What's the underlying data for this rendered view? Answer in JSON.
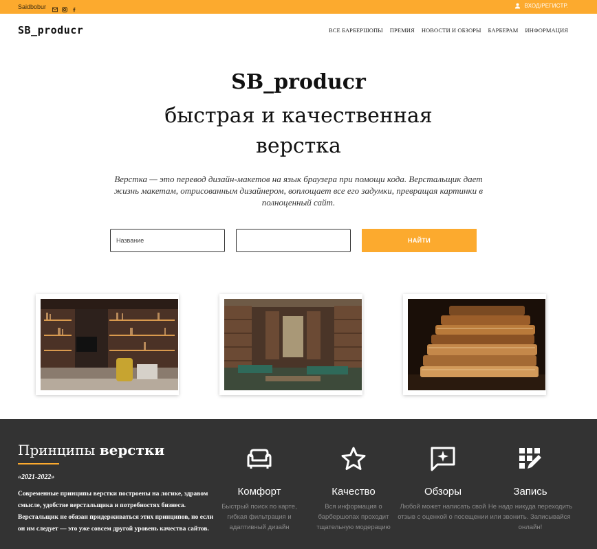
{
  "topbar": {
    "brand": "Saidbobur",
    "socials": [
      "mail-icon",
      "instagram-icon",
      "facebook-icon"
    ],
    "login_label": "ВХОД/РЕГИСТР."
  },
  "header": {
    "logo": "SB_producr",
    "nav": [
      "ВСЕ БАРБЕРШОПЫ",
      "ПРЕМИЯ",
      "НОВОСТИ И ОБЗОРЫ",
      "БАРБЕРАМ",
      "ИНФОРМАЦИЯ"
    ]
  },
  "hero": {
    "brand": "SB_producr",
    "title_line1": "быстрая и качественная",
    "title_line2": "верстка",
    "description": "Верстка — это перевод дизайн-макетов на язык браузера при помощи кода. Верстальщик дает жизнь макетам, отрисованным дизайнером, воплощает все его задумки, превращая картинки в полноценный сайт."
  },
  "search": {
    "name_placeholder": "Название",
    "second_value": "",
    "button_label": "НАЙТИ"
  },
  "gallery": [
    "modern-library-shelves-image",
    "old-library-hall-image",
    "antique-books-stack-image"
  ],
  "principles": {
    "title_regular": "Принципы ",
    "title_bold": "верстки",
    "years": "«2021-2022»",
    "text": "Современные принципы верстки построены на логике, здравом смысле, удобстве верстальщика и потребностях бизнеса. Верстальщик не обязан придерживаться этих принципов, но если он им следует — это уже совсем другой уровень качества сайтов."
  },
  "features": [
    {
      "icon": "sofa-icon",
      "title": "Комфорт",
      "desc": "Быстрый поиск по карте, гибкая фильтрация и адаптивный дизайн"
    },
    {
      "icon": "star-icon",
      "title": "Качество",
      "desc": "Вся информация о барбершопах проходит тщательную модерацию"
    },
    {
      "icon": "review-icon",
      "title": "Обзоры",
      "desc": "Любой может написать свой отзыв с оценкой о посещении"
    },
    {
      "icon": "booking-icon",
      "title": "Запись",
      "desc": "Не надо никуда переходить или звонить. Записывайся онлайн!"
    }
  ],
  "colors": {
    "accent": "#fcaa2e",
    "dark": "#333333"
  }
}
